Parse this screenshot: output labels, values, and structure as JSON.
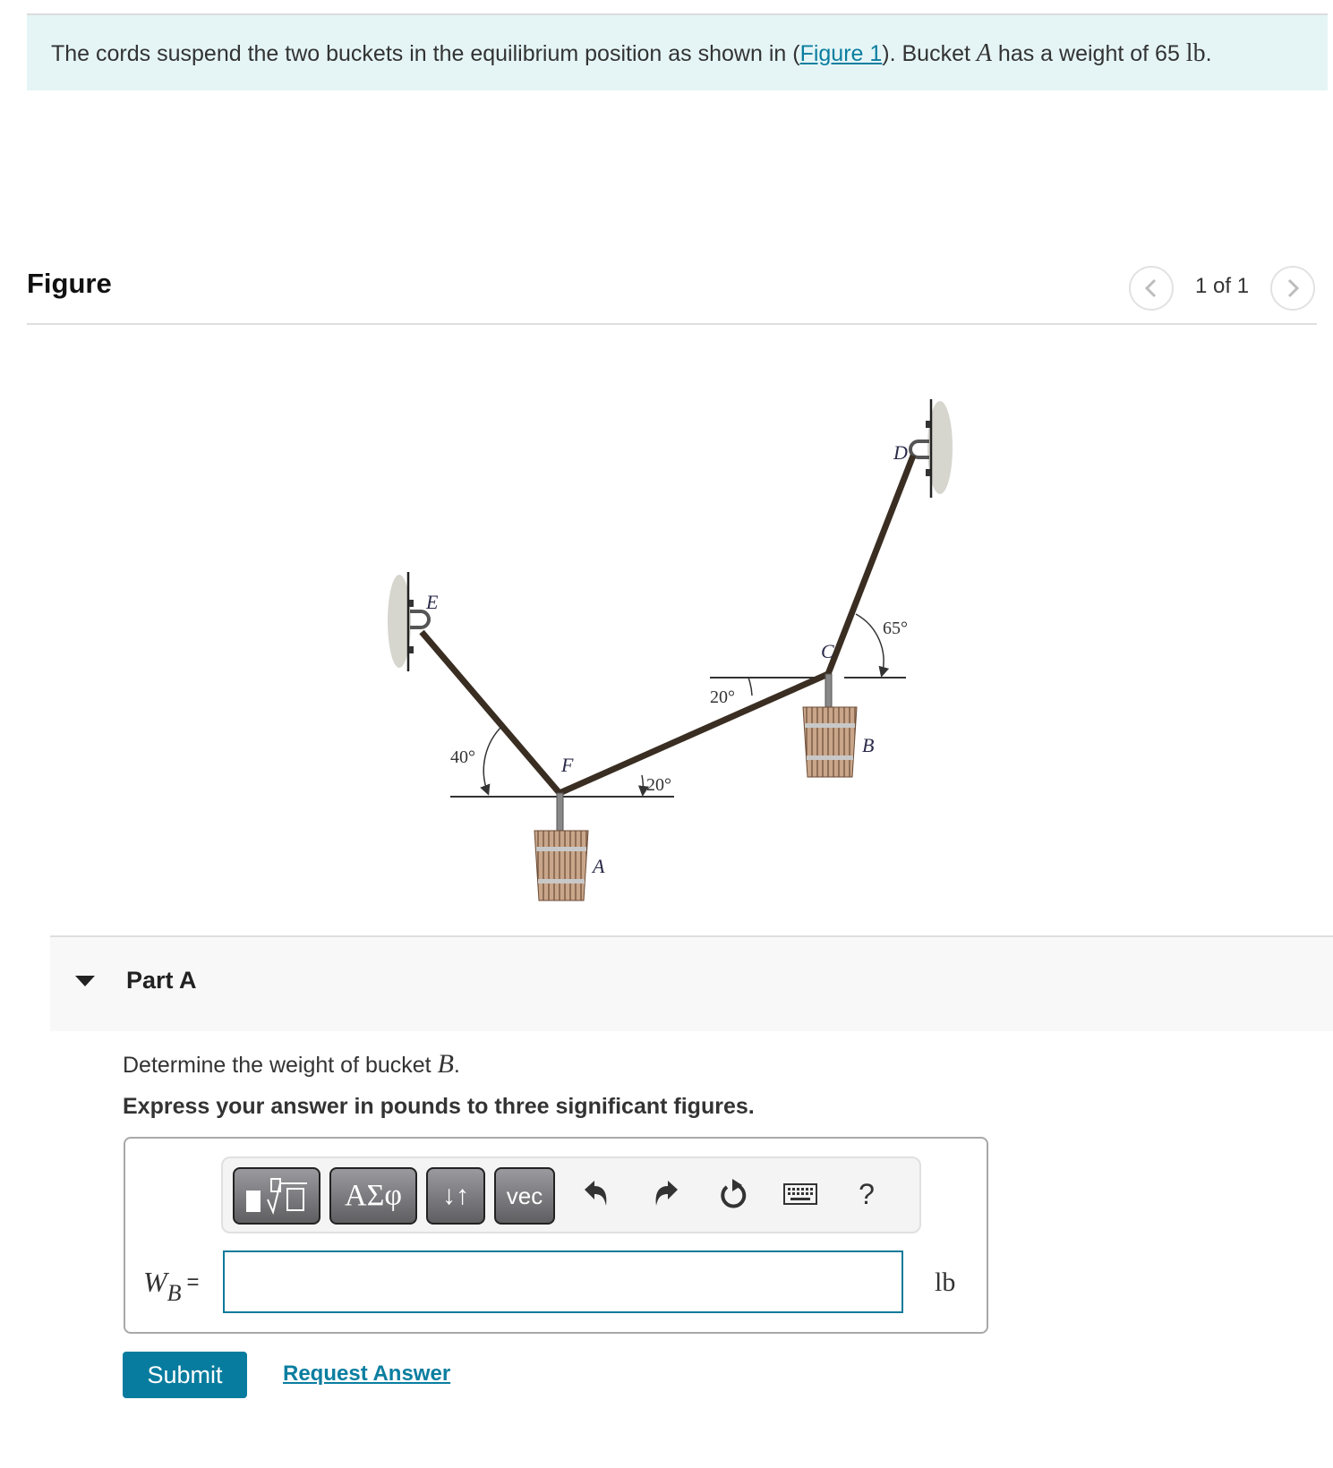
{
  "intro": {
    "text_before": "The cords suspend the two buckets in the equilibrium position as shown in (",
    "figure_link": "Figure 1",
    "text_middle": "). Bucket ",
    "var_a": "A",
    "text_after": " has a weight of 65 ",
    "unit": "lb",
    "period": "."
  },
  "figure": {
    "title": "Figure",
    "nav": {
      "prev_icon": "chevron-left-icon",
      "count": "1 of 1",
      "next_icon": "chevron-right-icon"
    },
    "labels": {
      "E": "E",
      "D": "D",
      "C": "C",
      "F": "F",
      "A": "A",
      "B": "B"
    },
    "angles": {
      "EF": "40°",
      "FC_at_F": "20°",
      "FC_at_C": "20°",
      "CD": "65°"
    }
  },
  "part_a": {
    "title": "Part A",
    "question_prefix": "Determine the weight of bucket ",
    "question_var": "B",
    "question_suffix": ".",
    "instruction": "Express your answer in pounds to three significant figures.",
    "toolbar": {
      "templates_icon": "fraction-root-template-icon",
      "greek_label": "ΑΣφ",
      "arrows_label": "↓↑",
      "vec_label": "vec",
      "undo_icon": "undo-icon",
      "redo_icon": "redo-icon",
      "reset_icon": "reset-icon",
      "keyboard_icon": "keyboard-icon",
      "help_label": "?"
    },
    "answer": {
      "label_var": "W",
      "label_sub": "B",
      "label_eq": "=",
      "value": "",
      "placeholder": "",
      "unit": "lb"
    },
    "submit_label": "Submit",
    "request_answer_label": "Request Answer"
  },
  "colors": {
    "accent": "#077c9e",
    "link": "#0a7ea0",
    "intro_bg": "#e5f5f6",
    "part_bg": "#f8f8f8"
  }
}
